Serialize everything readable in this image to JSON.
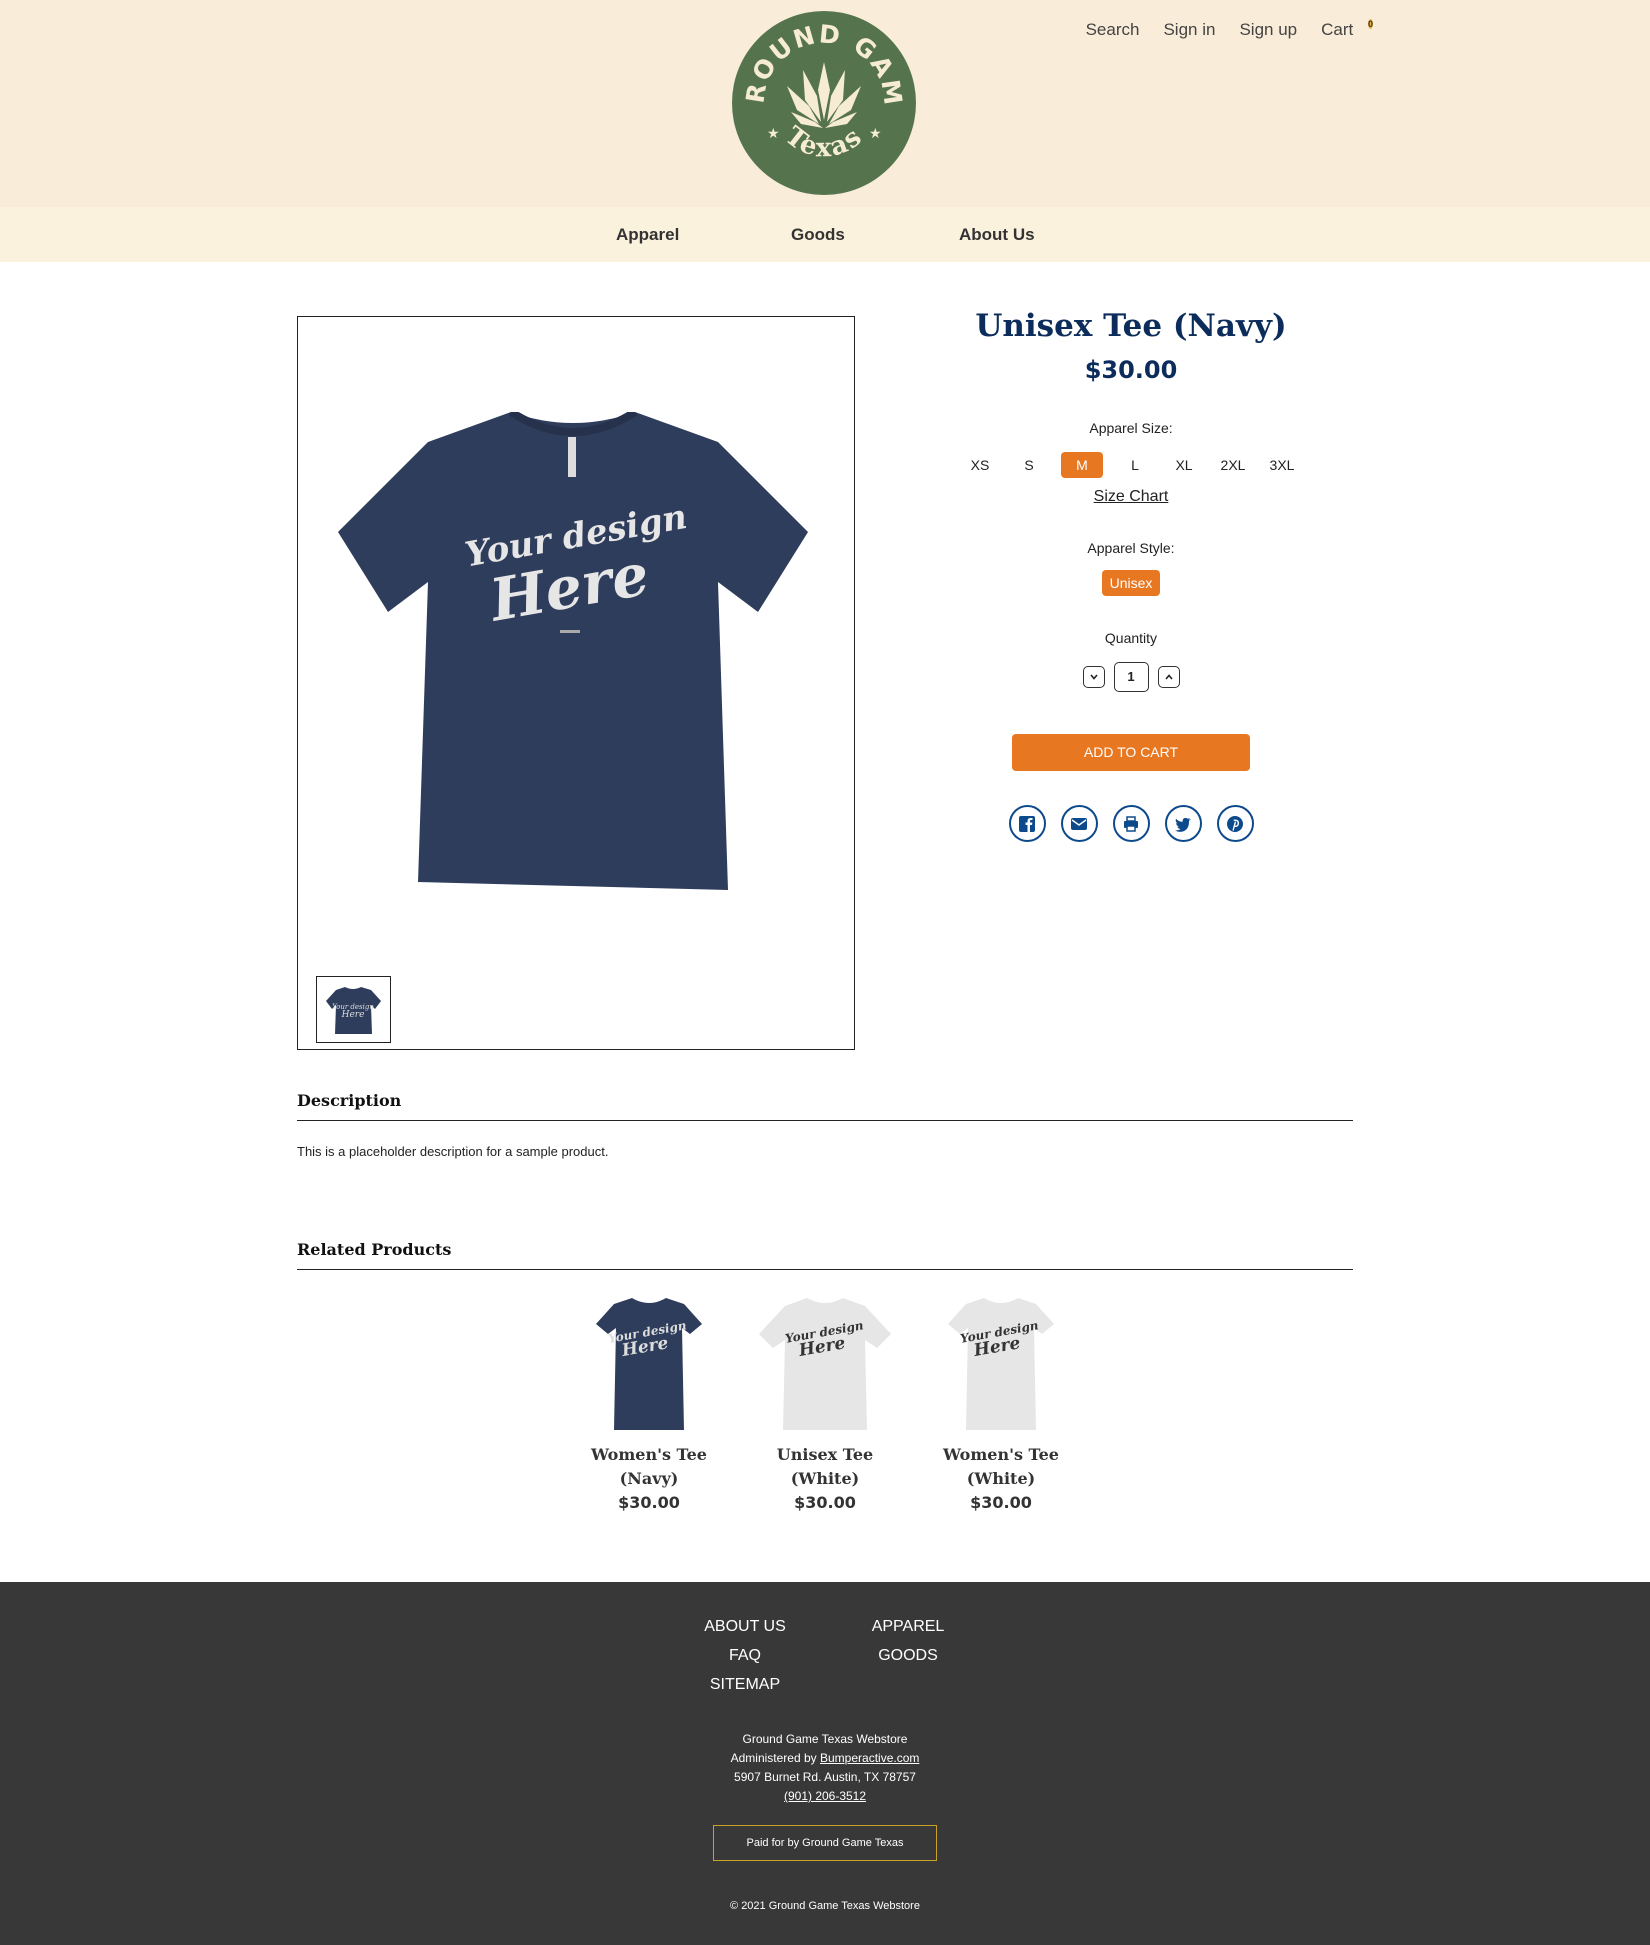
{
  "header": {
    "logo_text_top": "GROUND GAME",
    "logo_text_bottom": "Texas",
    "links": [
      "Search",
      "Sign in",
      "Sign up",
      "Cart"
    ],
    "cart_count": "0"
  },
  "nav": {
    "items": [
      "Apparel",
      "Goods",
      "About Us"
    ]
  },
  "product": {
    "title": "Unisex Tee (Navy)",
    "price": "$30.00",
    "shirt_text_1": "Your design",
    "shirt_text_2": "Here",
    "size_label": "Apparel Size:",
    "sizes": [
      "XS",
      "S",
      "M",
      "L",
      "XL",
      "2XL",
      "3XL"
    ],
    "selected_size": "M",
    "size_chart": "Size Chart",
    "style_label": "Apparel Style:",
    "style_value": "Unisex",
    "quantity_label": "Quantity",
    "quantity": "1",
    "add_to_cart": "ADD TO CART",
    "shirt_color": "#2f3d5c"
  },
  "description": {
    "title": "Description",
    "text": "This is a placeholder description for a sample product."
  },
  "related": {
    "title": "Related Products",
    "items": [
      {
        "name_line1": "Women's Tee",
        "name_line2": "(Navy)",
        "price": "$30.00",
        "color": "#2f3d5c"
      },
      {
        "name_line1": "Unisex Tee",
        "name_line2": "(White)",
        "price": "$30.00",
        "color": "#e6e6e6"
      },
      {
        "name_line1": "Women's Tee",
        "name_line2": "(White)",
        "price": "$30.00",
        "color": "#e6e6e6"
      }
    ]
  },
  "footer": {
    "col1": [
      "ABOUT US",
      "FAQ",
      "SITEMAP"
    ],
    "col2": [
      "APPAREL",
      "GOODS"
    ],
    "store_name": "Ground Game Texas Webstore",
    "admin_prefix": "Administered by",
    "admin_link": "Bumperactive.com",
    "address": "5907 Burnet Rd. Austin, TX 78757",
    "phone": "(901) 206-3512",
    "paid_for": "Paid for by Ground Game Texas",
    "copyright": "© 2021 Ground Game Texas Webstore"
  },
  "colors": {
    "accent": "#e87722",
    "brand_navy": "#0c2d5c",
    "logo_green": "#55744e",
    "header_bg": "#f9ecd8",
    "footer_bg": "#383838"
  }
}
